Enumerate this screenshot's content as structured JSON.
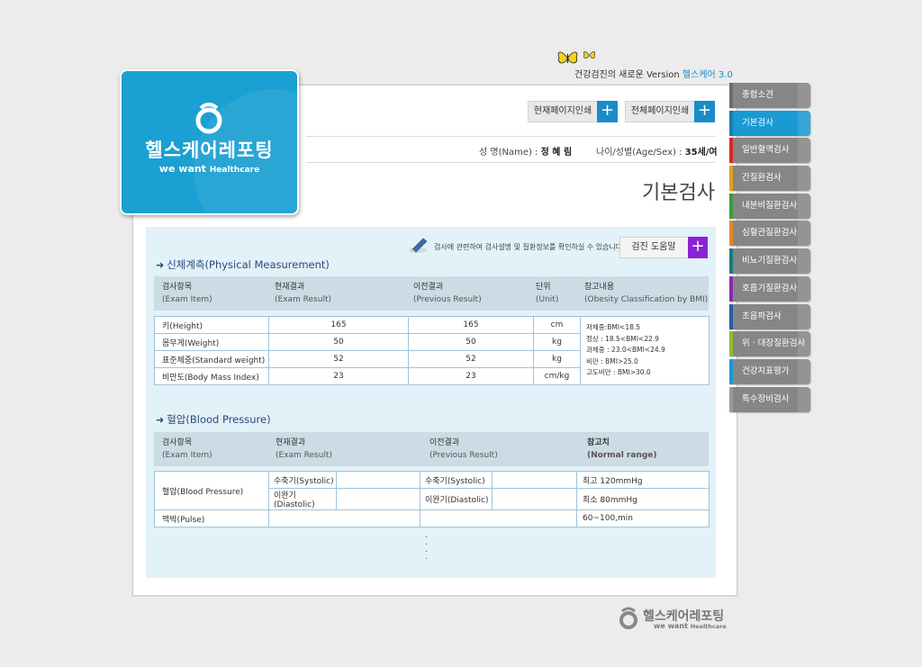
{
  "tagline": {
    "text": "건강검진의 새로운 Version ",
    "version": "헬스케어 3.0"
  },
  "logo": {
    "title": "헬스케어레포팅",
    "sub_main": "we want ",
    "sub_small": "Healthcare"
  },
  "toolbar": {
    "print_current": "현재페이지인쇄",
    "print_all": "전체페이지인쇄"
  },
  "patient": {
    "name_label": "성 명(Name) : ",
    "name_value": "정 혜 림",
    "age_label": "나이/성별(Age/Sex) : ",
    "age_value": "35세/여"
  },
  "page_title": "기본검사",
  "info": {
    "text": "검사에 관련하여 검사설명 및 질환정보를 확인하실 수 있습니다.",
    "help_label": "검진 도움말"
  },
  "physical": {
    "title": "신체계측(Physical Measurement)",
    "headers": [
      {
        "ko": "검사항목",
        "en": "(Exam Item)"
      },
      {
        "ko": "현재결과",
        "en": "(Exam Result)"
      },
      {
        "ko": "이전결과",
        "en": "(Previous Result)"
      },
      {
        "ko": "단위",
        "en": "(Unit)"
      },
      {
        "ko": "참고내용",
        "en": "(Obesity Classification by BMI)"
      }
    ],
    "rows": [
      {
        "item": "키(Height)",
        "current": "165",
        "previous": "165",
        "unit": "cm"
      },
      {
        "item": "몸무게(Weight)",
        "current": "50",
        "previous": "50",
        "unit": "kg"
      },
      {
        "item": "표준체중(Standard weight)",
        "current": "52",
        "previous": "52",
        "unit": "kg"
      },
      {
        "item": "비만도(Body Mass Index)",
        "current": "23",
        "previous": "23",
        "unit": "cm/kg"
      }
    ],
    "reference": [
      "저체중:BMI<18.5",
      "정상 : 18.5<BMI<22.9",
      "과체중 : 23.0<BMI<24.9",
      "비만 : BMI>25.0",
      "고도비만 : BMI>30.0"
    ]
  },
  "bp": {
    "title": "혈압(Blood Pressure)",
    "headers": [
      {
        "ko": "검사항목",
        "en": "(Exam Item)"
      },
      {
        "ko": "현재결과",
        "en": "(Exam Result)"
      },
      {
        "ko": "이전결과",
        "en": "(Previous Result)"
      },
      {
        "ko": "참고치",
        "en": "(Normal range)"
      }
    ],
    "item_bp": "혈압(Blood Pressure)",
    "systolic": "수축기(Systolic)",
    "diastolic": "이완기(Diastolic)",
    "ref_sys": "최고 120mmHg",
    "ref_dia": "최소 80mmHg",
    "item_pulse": "맥박(Pulse)",
    "ref_pulse": "60~100,min"
  },
  "tabs": [
    {
      "label": "종합소견",
      "color": "#6d6d6d"
    },
    {
      "label": "기본검사",
      "color": "#1a7fb0"
    },
    {
      "label": "일반혈액검사",
      "color": "#d8282a"
    },
    {
      "label": "간질환검사",
      "color": "#e0a020"
    },
    {
      "label": "내분비질환검사",
      "color": "#3a9a3a"
    },
    {
      "label": "심혈관질환검사",
      "color": "#e8862a"
    },
    {
      "label": "비뇨기질환검사",
      "color": "#1a7a7a"
    },
    {
      "label": "호흡기질환검사",
      "color": "#8a2ab0"
    },
    {
      "label": "초음파검사",
      "color": "#2a5aa0"
    },
    {
      "label": "위 · 대장질환검사",
      "color": "#8ac030"
    },
    {
      "label": "건강지표평가",
      "color": "#1a9ad2"
    },
    {
      "label": "특수장비검사",
      "color": "#9a9a9a"
    }
  ],
  "footer": {
    "title": "헬스케어레포팅",
    "sub_main": "we want ",
    "sub_small": "Healthcare"
  }
}
